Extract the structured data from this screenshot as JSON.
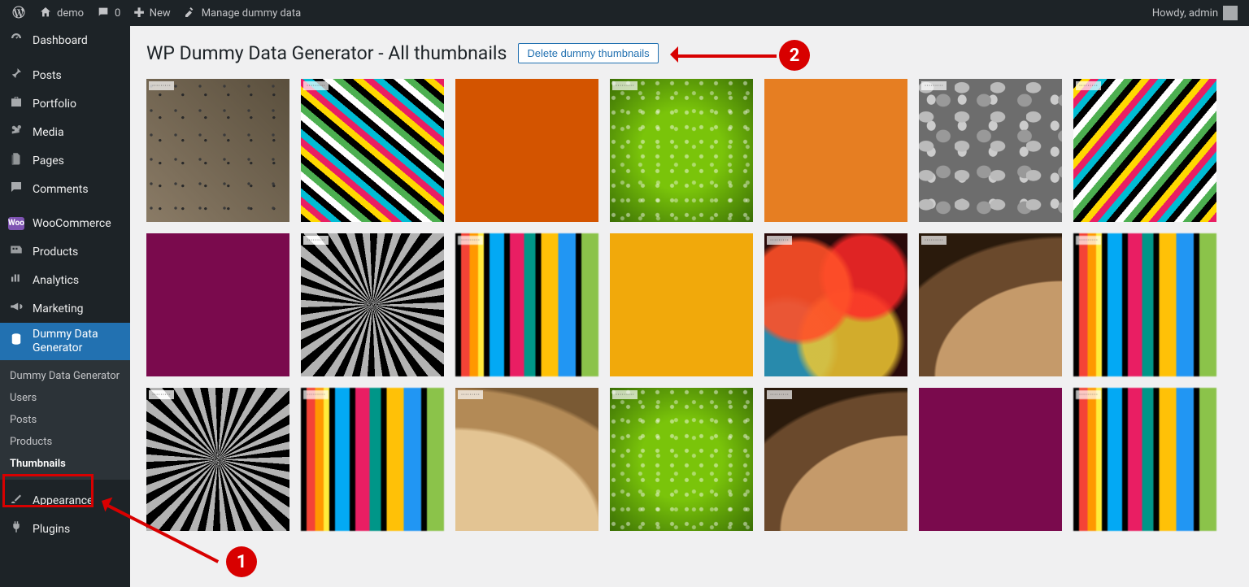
{
  "adminbar": {
    "site_name": "demo",
    "comment_count": "0",
    "new_label": "New",
    "manage_label": "Manage dummy data",
    "howdy": "Howdy, admin"
  },
  "sidebar": {
    "items": [
      {
        "label": "Dashboard"
      },
      {
        "label": "Posts"
      },
      {
        "label": "Portfolio"
      },
      {
        "label": "Media"
      },
      {
        "label": "Pages"
      },
      {
        "label": "Comments"
      },
      {
        "label": "WooCommerce"
      },
      {
        "label": "Products"
      },
      {
        "label": "Analytics"
      },
      {
        "label": "Marketing"
      },
      {
        "label": "Dummy Data Generator"
      },
      {
        "label": "Appearance"
      },
      {
        "label": "Plugins"
      }
    ],
    "submenu": [
      {
        "label": "Dummy Data Generator"
      },
      {
        "label": "Users"
      },
      {
        "label": "Posts"
      },
      {
        "label": "Products"
      },
      {
        "label": "Thumbnails"
      }
    ]
  },
  "page": {
    "title": "WP Dummy Data Generator - All thumbnails",
    "delete_btn": "Delete dummy thumbnails"
  },
  "annotations": {
    "a1": "1",
    "a2": "2"
  }
}
